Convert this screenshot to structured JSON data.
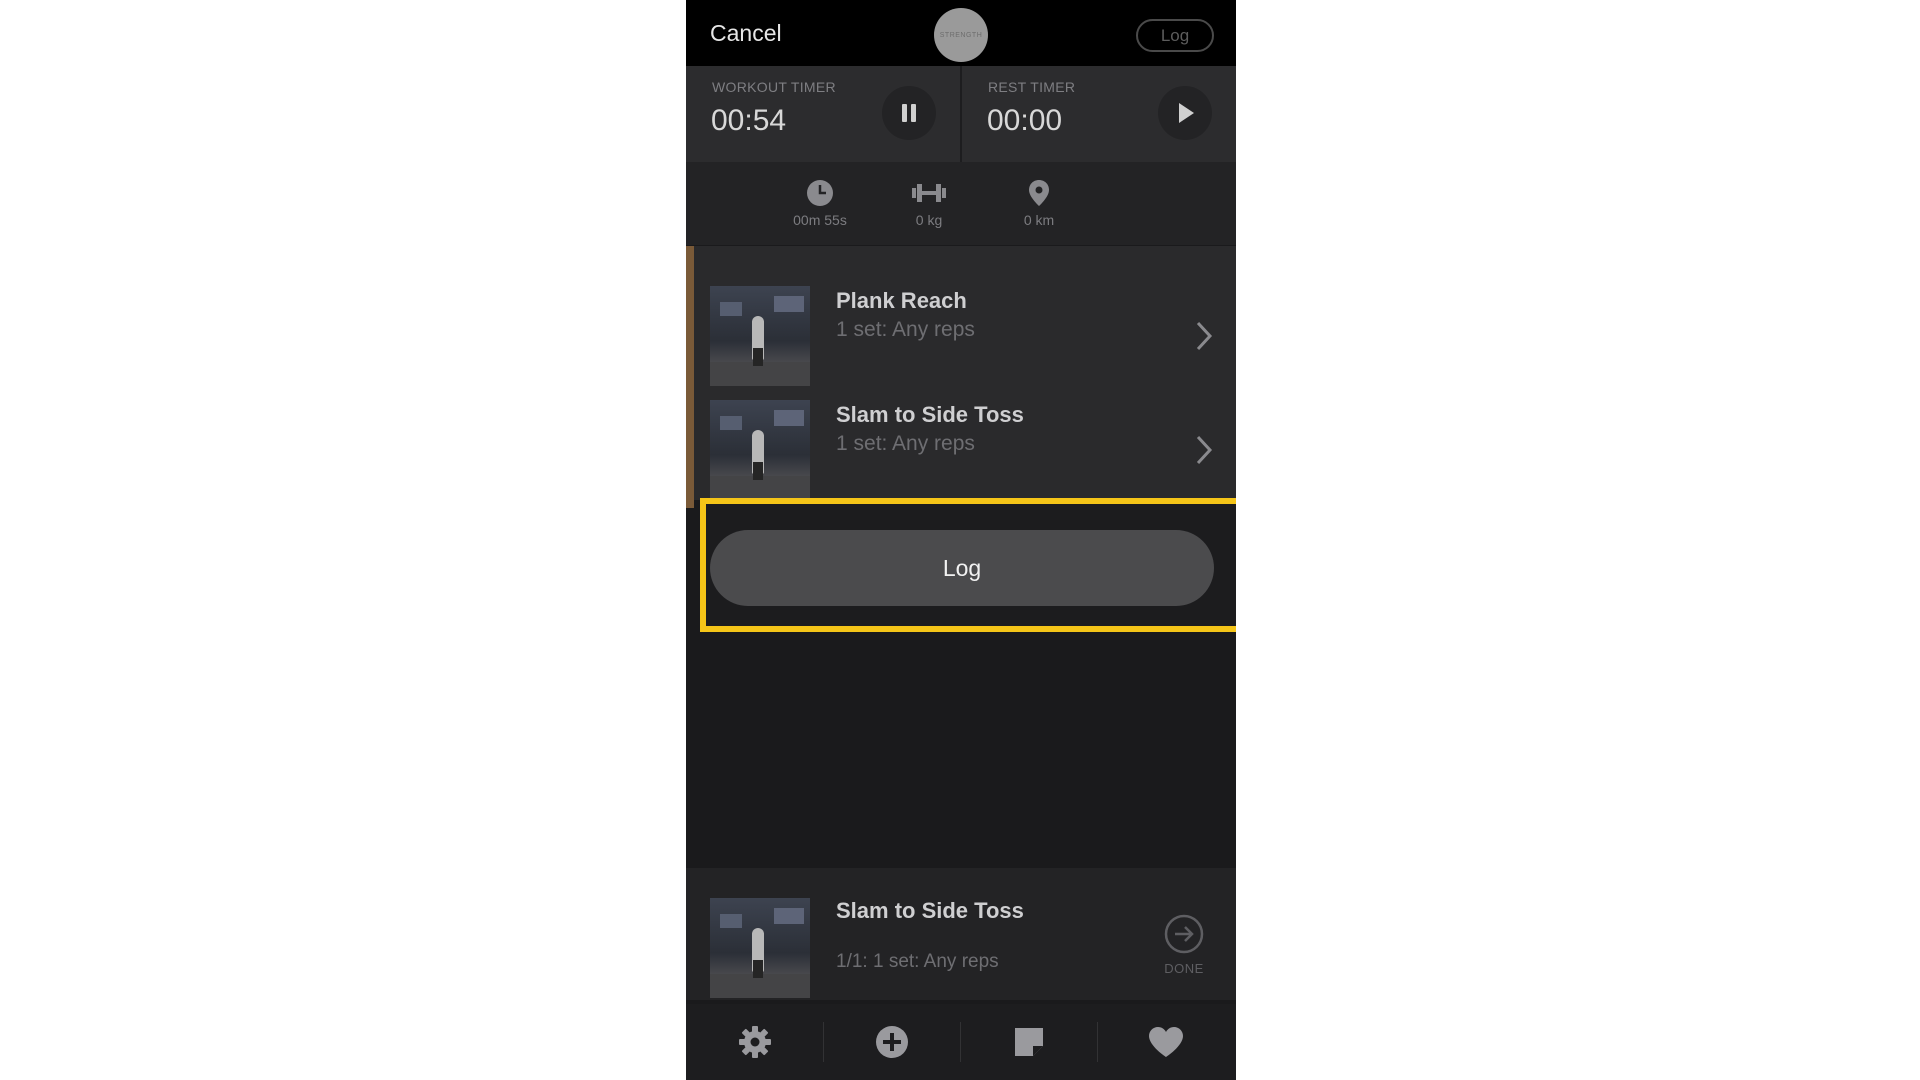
{
  "topbar": {
    "cancel_label": "Cancel",
    "log_label": "Log",
    "logo_text": "STRENGTH"
  },
  "timers": {
    "workout": {
      "label": "WORKOUT TIMER",
      "value": "00:54",
      "control": "pause-icon"
    },
    "rest": {
      "label": "REST TIMER",
      "value": "00:00",
      "control": "play-icon"
    }
  },
  "stats": [
    {
      "icon": "clock-icon",
      "value": "00m 55s"
    },
    {
      "icon": "dumbbell-icon",
      "value": "0 kg"
    },
    {
      "icon": "location-pin-icon",
      "value": "0 km"
    }
  ],
  "exercises": [
    {
      "title": "Plank Reach",
      "subtitle": "1 set: Any reps"
    },
    {
      "title": "Slam to Side Toss",
      "subtitle": "1 set: Any reps"
    }
  ],
  "log_button": {
    "label": "Log",
    "highlight_color": "#f5c518"
  },
  "current_exercise": {
    "title": "Slam to Side Toss",
    "subtitle": "1/1:  1 set: Any reps",
    "done_label": "DONE"
  },
  "nav": [
    {
      "icon": "gear-icon"
    },
    {
      "icon": "plus-circle-icon"
    },
    {
      "icon": "note-icon"
    },
    {
      "icon": "heart-icon"
    }
  ]
}
